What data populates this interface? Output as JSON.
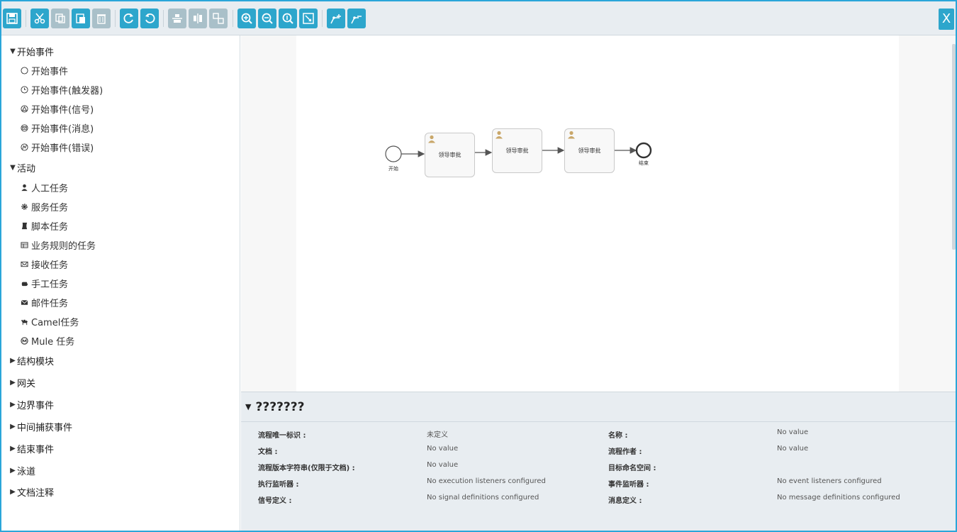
{
  "toolbar": {
    "close_label": "X",
    "buttons": [
      "save-icon",
      "cut-icon",
      "copy-icon",
      "paste-icon",
      "delete-icon",
      "redo-icon",
      "undo-icon",
      "align-horizontal-icon",
      "align-vertical-icon",
      "same-size-icon",
      "zoom-in-icon",
      "zoom-out-icon",
      "zoom-actual-icon",
      "zoom-fit-icon",
      "add-bendpoint-icon",
      "remove-bendpoint-icon"
    ]
  },
  "sidebar": {
    "start_events": {
      "label": "开始事件",
      "items": [
        "开始事件",
        "开始事件(触发器)",
        "开始事件(信号)",
        "开始事件(消息)",
        "开始事件(错误)"
      ]
    },
    "activities": {
      "label": "活动",
      "items": [
        "人工任务",
        "服务任务",
        "脚本任务",
        "业务规则的任务",
        "接收任务",
        "手工任务",
        "邮件任务",
        "Camel任务",
        "Mule 任务"
      ]
    },
    "structural": "结构模块",
    "gateways": "网关",
    "boundary_events": "边界事件",
    "intermediate_catch": "中间捕获事件",
    "end_events": "结束事件",
    "swimlanes": "泳道",
    "annotations": "文档注释"
  },
  "diagram": {
    "start_label": "开始",
    "end_label": "结束",
    "tasks": [
      "领导审批",
      "领导审批",
      "领导审批"
    ]
  },
  "properties": {
    "title": "???????",
    "rows": [
      {
        "label": "流程唯一标识 :",
        "value": "未定义",
        "label2": "名称 :",
        "value2": "No value"
      },
      {
        "label": "文档 :",
        "value": "No value",
        "label2": "流程作者 :",
        "value2": "No value"
      },
      {
        "label": "流程版本字符串(仅限于文档) :",
        "value": "No value",
        "label2": "目标命名空间 :",
        "value2": ""
      },
      {
        "label": "执行监听器 :",
        "value": "No execution listeners configured",
        "label2": "事件监听器 :",
        "value2": "No event listeners configured"
      },
      {
        "label": "信号定义 :",
        "value": "No signal definitions configured",
        "label2": "消息定义 :",
        "value2": "No message definitions configured"
      }
    ]
  },
  "colors": {
    "accent": "#2da6cc",
    "frame": "#2aa6d9",
    "panel": "#e8edf1"
  }
}
